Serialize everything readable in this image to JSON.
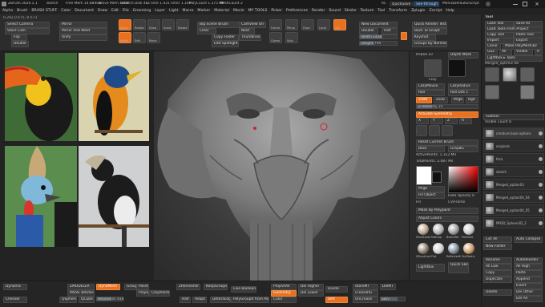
{
  "title_bar": {
    "app": "ZBrush 2020.1.1",
    "doc": "sketch",
    "free_mem": "Free Mem 14.884GB",
    "active_mem": "Active Mem 2008",
    "scratch": "Scratch Disk 48",
    "ztime": "ZTime 1.431",
    "timer": "Timer 1.109",
    "polycount": "PolyCount 1.375 MP",
    "meshcount": "MeshCount 2",
    "ac": "AC",
    "quicksave": "QuickSave",
    "see_through": "See-through 0",
    "menus": "Menus",
    "default_script": "DefaultZScript"
  },
  "menu_bar": [
    "Alpha",
    "Brush",
    "BRUSH STUFF",
    "Color",
    "Document",
    "Draw",
    "Edit",
    "File",
    "Grooming",
    "Layer",
    "Light",
    "Macro",
    "Marker",
    "Material",
    "Movie",
    "MY TOOLS",
    "Picker",
    "Preferences",
    "Render",
    "Sound",
    "Stroke",
    "Texture",
    "Tool",
    "Transform",
    "Zplugin",
    "Zscript",
    "Help"
  ],
  "coords": "0.242,0.475,-0.573",
  "toolbar": {
    "select_camera": "Select Camera",
    "store_cam": "Store Cam",
    "flip": "Flip",
    "mirror": "Mirror",
    "mirror_and_weld": "Mirror And Weld",
    "unify": "Unify",
    "double": "Double",
    "big_scene_brush": "Big Scene Brush",
    "clear": "Clear",
    "copy_folder": "Copy Folder",
    "edit_spotlight": "Edit Spotlight",
    "camview_on": "CamView On",
    "next": "Next",
    "thumbnail": "Thumbnail",
    "new_document": "New Document",
    "quick_render": "Quick Render Test",
    "double2": "Double",
    "back_to_sculpt": "Back To Sculpt",
    "keyshot": "Keyshot",
    "groups_by_normals": "Groups By Normals",
    "width_label": "Width 1436",
    "height_label": "Height 794",
    "half": "Half"
  },
  "icon_row": [
    "Move",
    "Scale",
    "Rotate",
    "Edit",
    "Draw",
    "Move",
    "Scale",
    "Rotate",
    "Frame",
    "Persp",
    "Floor",
    "Local",
    "Xyz",
    "Gizmo",
    "Solo"
  ],
  "left_panel": {
    "photo_count": 4
  },
  "right_panel_a": {
    "embed": "Imbed 10",
    "depth_mask": "Depth Mask",
    "clay": "Clay",
    "lazy_mouse": "LazyMouse",
    "lazy_radius": "LazyRadius",
    "roll": "Roll",
    "roll_dist": "Roll Dist 1",
    "zadd": "Zadd",
    "zsub": "Zsub",
    "mrgb": "Mrgb",
    "rgb": "Rgb",
    "m": "M",
    "z_intensity": "Z Intensity 25",
    "activate_symmetry": "Activate Symmetry",
    "x": "X",
    "y": "Y",
    "z": "Z",
    "r": "R",
    "reset_current_brush": "Reset Current Brush",
    "back": "Back",
    "gray_bg": "GrayBG",
    "active_points": "ActivePoints: 1.313 Mil",
    "total_points": "TotalPoints: 2.087 Mil",
    "mrgb2": "Mrgb",
    "fill_object": "Fill Object",
    "fill": "Fill",
    "cv_frame": "CV/Frame",
    "fade_opacity": "Fade Opacity 0",
    "mask_by_polypaint": "Mask By Polypaint",
    "adjust_colors": "Adjust Colors",
    "materials": [
      "SkinShade4",
      "MatCap",
      "BasicMat",
      "Polished",
      "ZBrushLoom",
      "Flat",
      "ReflectedMap",
      "ToyPlastic"
    ],
    "light_box": "LightBox",
    "quick_sketch": "Quick Sketch"
  },
  "right_panel_b": {
    "tool_title": "Tool",
    "load_tool": "Load Tool",
    "save_as": "Save As",
    "load_tools_from_project": "Load Tools From Project",
    "copy_tool": "Copy Tool",
    "paste_tool": "Paste Tool",
    "import": "Import",
    "export": "Export",
    "clone": "Clone",
    "make_polymesh3d": "Make PolyMesh3D",
    "goz": "GoZ",
    "all": "All",
    "visible": "Visible",
    "r": "R",
    "lightbox_tools": "Lightbox ▸ Tools",
    "merged_name": "Merged_optimiz 48",
    "subtool": "Subtool",
    "visible_count": "Visible Count 8",
    "subtools": [
      "creature base options",
      "originals",
      "feck",
      "sketch",
      "Merged_option03",
      "Merged_option04_04",
      "Merged_option04_05",
      "PM3D_Sphere3D_2"
    ],
    "list_all": "List All",
    "auto_collapse": "Auto Collapse",
    "new_folder": "New Folder",
    "rename": "Rename",
    "auto_reorder": "AutoReorder",
    "all_low": "All Low",
    "all_high": "All High",
    "copy": "Copy",
    "paste": "Paste",
    "duplicate": "Duplicate",
    "append": "Append",
    "insert": "Insert",
    "delete": "Delete",
    "del_other": "Del Other",
    "del_all": "Del All"
  },
  "bottom_bar": {
    "dynamic": "Dynamic",
    "checker": "Checker",
    "zmodeler": "ZMODELER",
    "move_brush": "MOVE BRUSH",
    "qsphere": "QSphere",
    "qcube": "QCube",
    "dynamesh": "DynaMesh",
    "resolution": "Resolution 616",
    "groups": "Groups",
    "polish": "Polish",
    "project": "Project",
    "clay_polish": "ClayPolish",
    "zremesher": "ZRemesher",
    "keep_groups": "KeepGroups",
    "half": "Half",
    "adapt": "Adapt",
    "detect_edges": "DetectEdges",
    "live_boolean": "Live Boolean",
    "polygroupit": "PolyGroupIt from Paint",
    "project_all": "ProjectAll",
    "del_higher": "Del Higher",
    "geometry": "Geometry",
    "del_lower": "Del Lower",
    "color": "Color",
    "divide": "Divide",
    "smt": "Smt",
    "store_mt": "StoreMT",
    "crease_pg": "CreasePG",
    "uncrease": "UnCrease",
    "del_mt": "DelMT",
    "sdiv": "SDiv"
  },
  "colors": {
    "accent": "#e8701f",
    "bg": "#2a2a2a",
    "panel": "#2e2e2e",
    "bar": "#1e1e1e"
  }
}
